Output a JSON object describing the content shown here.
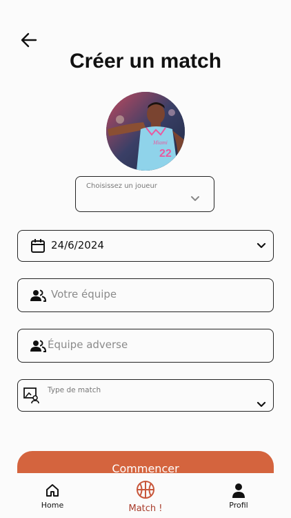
{
  "header": {
    "title": "Créer un match"
  },
  "player_select": {
    "label": "Choisissez un joueur"
  },
  "form": {
    "date_value": "24/6/2024",
    "team_placeholder": "Votre équipe",
    "opponent_placeholder": "Équipe adverse",
    "match_type_label": "Type de match"
  },
  "start_button": {
    "label": "Commencer"
  },
  "nav": {
    "items": [
      {
        "label": "Home",
        "icon": "home-icon"
      },
      {
        "label": "Match !",
        "icon": "basketball-icon",
        "active": true
      },
      {
        "label": "Profil",
        "icon": "person-icon"
      }
    ]
  },
  "colors": {
    "accent": "#d4643e",
    "active_nav": "#a83b2a",
    "background": "#fbfbfb"
  }
}
